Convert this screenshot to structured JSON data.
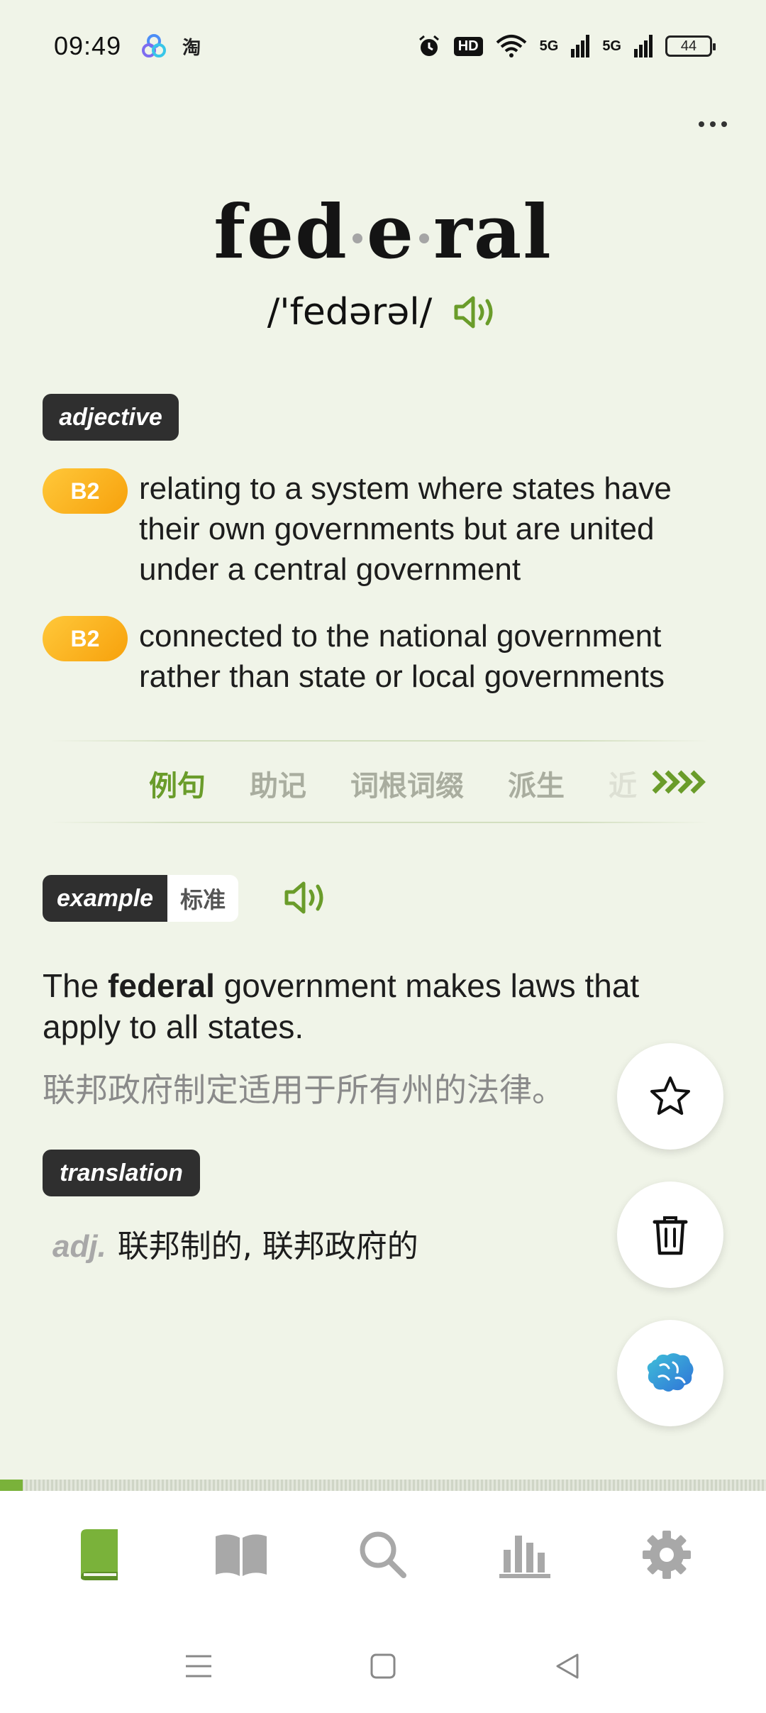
{
  "status_bar": {
    "time": "09:49",
    "app_label": "淘",
    "hd_label": "HD",
    "signal_1": "5G",
    "signal_2": "5G",
    "battery": "44"
  },
  "word": {
    "syllables": [
      "fed",
      "e",
      "ral"
    ],
    "pronunciation": "/'fedərəl/"
  },
  "pos_tag": "adjective",
  "senses": [
    {
      "level": "B2",
      "text": "relating to a system where states have their own governments but are united under a central government"
    },
    {
      "level": "B2",
      "text": "connected to the national government rather than state or local governments"
    }
  ],
  "tabs": [
    {
      "label": "例句",
      "active": true
    },
    {
      "label": "助记",
      "active": false
    },
    {
      "label": "词根词缀",
      "active": false
    },
    {
      "label": "派生",
      "active": false
    },
    {
      "label": "近",
      "active": false
    }
  ],
  "example": {
    "tag": "example",
    "accent": "标准",
    "sentence_before": "The ",
    "sentence_bold": "federal",
    "sentence_after": " government makes laws that apply to all states.",
    "translation_zh": "联邦政府制定适用于所有州的法律。"
  },
  "translation": {
    "tag": "translation",
    "pos": "adj.",
    "text": "联邦制的, 联邦政府的"
  },
  "progress": {
    "fraction": 0.03
  },
  "colors": {
    "accent_green": "#6a9c2a",
    "badge_orange": "#f7a10c",
    "background": "#f0f4e8",
    "tag_dark": "#2f2f2f"
  },
  "icons": {
    "fab_1": "star-icon",
    "fab_2": "trash-icon",
    "fab_3": "brain-icon",
    "nav": [
      "book-icon",
      "open-book-icon",
      "search-icon",
      "stats-icon",
      "gear-icon"
    ],
    "system": [
      "menu-icon",
      "home-icon",
      "back-icon"
    ]
  }
}
